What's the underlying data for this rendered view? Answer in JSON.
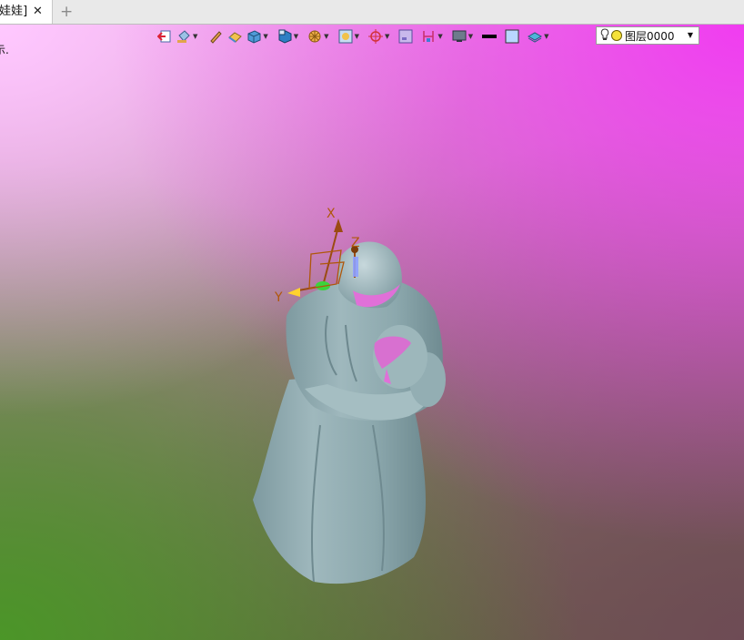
{
  "tab": {
    "title": "[娃娃]",
    "close": "✕",
    "add": "+"
  },
  "viewport": {
    "status_hint": "示.",
    "axes": {
      "x": "X",
      "y": "Y",
      "z": "Z"
    }
  },
  "toolbar": {
    "buttons": [
      {
        "name": "exit-sketch",
        "icon": "exit-icon",
        "dropdown": false
      },
      {
        "name": "paint",
        "icon": "paint-bucket-icon",
        "dropdown": true
      },
      {
        "name": "pen",
        "icon": "pen-icon",
        "dropdown": false
      },
      {
        "name": "eraser",
        "icon": "eraser-icon",
        "dropdown": false
      },
      {
        "name": "shaded-cube",
        "icon": "shaded-cube-icon",
        "dropdown": true
      },
      {
        "name": "view-orient",
        "icon": "view-cube-icon",
        "dropdown": true
      },
      {
        "name": "section",
        "icon": "section-wheel-icon",
        "dropdown": true
      },
      {
        "name": "filter",
        "icon": "filter-icon",
        "dropdown": true
      },
      {
        "name": "snap",
        "icon": "snap-target-icon",
        "dropdown": true
      },
      {
        "name": "sketch-plane",
        "icon": "sketch-plane-icon",
        "dropdown": false
      },
      {
        "name": "dimension",
        "icon": "dimension-icon",
        "dropdown": true
      },
      {
        "name": "display",
        "icon": "display-monitor-icon",
        "dropdown": true
      },
      {
        "name": "line-style",
        "icon": "line-style-icon",
        "dropdown": false
      },
      {
        "name": "color",
        "icon": "color-swatch-icon",
        "dropdown": false
      },
      {
        "name": "layers",
        "icon": "layers-icon",
        "dropdown": true
      }
    ],
    "layer_value": "图层0000",
    "colors": {
      "accent": "#3a7fd8",
      "swatch": "#b9d7ff"
    }
  }
}
